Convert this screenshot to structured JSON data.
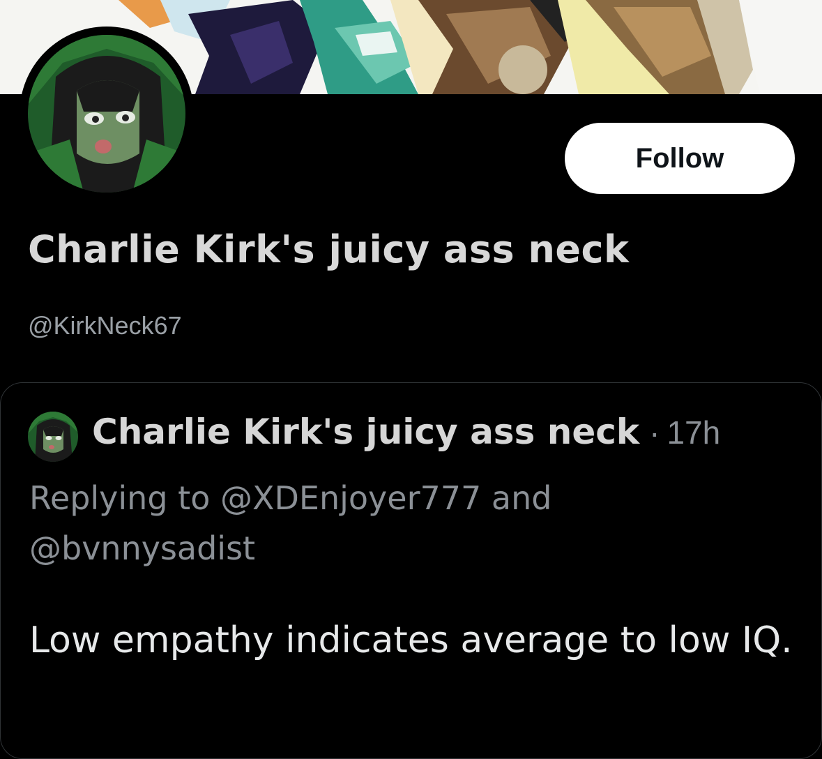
{
  "profile": {
    "display_name": "Charlie Kirk's juicy ass neck",
    "handle": "@KirkNeck67",
    "follow_label": "Follow"
  },
  "tweet": {
    "author": "Charlie Kirk's juicy ass neck",
    "separator": "·",
    "time": "17h",
    "replying_prefix": "Replying to",
    "mention_1": "@XDEnjoyer777",
    "joiner": "and",
    "mention_2": "@bvnnysadist",
    "text": "Low empathy indicates average to low IQ."
  },
  "icons": {
    "banner": "banner-artwork",
    "avatar": "anime-character-avatar"
  },
  "colors": {
    "background": "#000000",
    "follow_bg": "#ffffff",
    "secondary_text": "#8b9096",
    "card_border": "#2f3336"
  }
}
